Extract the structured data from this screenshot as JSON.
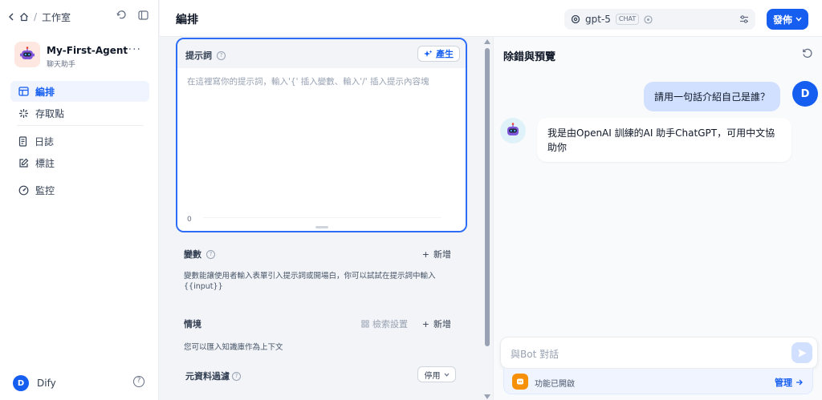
{
  "breadcrumb": {
    "studio": "工作室"
  },
  "app": {
    "name": "My-First-Agent",
    "type": "聊天助手"
  },
  "nav": [
    {
      "label": "編排",
      "icon": "layout-icon"
    },
    {
      "label": "存取點",
      "icon": "api-icon"
    },
    {
      "label": "日誌",
      "icon": "logs-icon"
    },
    {
      "label": "標註",
      "icon": "annotation-icon"
    },
    {
      "label": "監控",
      "icon": "monitor-icon"
    }
  ],
  "user": {
    "initial": "D",
    "name": "Dify"
  },
  "header": {
    "title": "編排",
    "model": "gpt-5",
    "model_badge": "CHAT",
    "publish": "發佈"
  },
  "prompt": {
    "label": "提示詞",
    "generate": "產生",
    "placeholder": "在這裡寫你的提示詞，輸入'{' 插入變數、輸入'/' 插入提示內容塊",
    "count": "0"
  },
  "variables": {
    "title": "變數",
    "add": "新增",
    "desc": "變數能讓使用者輸入表單引入提示詞或開場白，你可以試試在提示詞中輸入 {{input}}"
  },
  "context": {
    "title": "情境",
    "retrieval": "檢索設置",
    "add": "新增",
    "desc": "您可以匯入知識庫作為上下文",
    "metadata_filter": "元資料過濾",
    "filter_value": "停用"
  },
  "preview": {
    "title": "除錯與預覽",
    "user_initial": "D",
    "user_message": "請用一句話介紹自己是誰？",
    "bot_message": "我是由OpenAI 訓練的AI 助手ChatGPT，可用中文協助你",
    "input_placeholder": "與Bot 對話",
    "features": "功能已開啟",
    "manage": "管理"
  },
  "colors": {
    "accent": "#155eef",
    "user_bubble": "#d1e0ff",
    "feature_icon": "#f79009"
  }
}
